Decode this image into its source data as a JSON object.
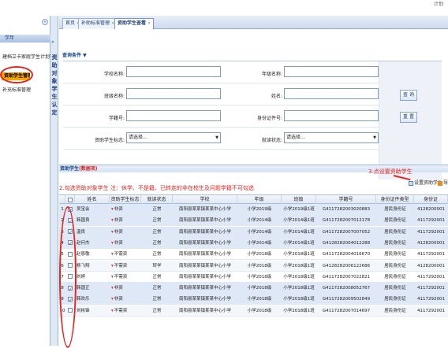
{
  "top": {
    "right_text": "计划"
  },
  "sidebar": {
    "section": "学年",
    "items": [
      "建档立卡家庭学生计划管理",
      "资助学生管理",
      "补充标准管理"
    ]
  },
  "strip": {
    "text": "资助对象学生认定"
  },
  "tabs": [
    {
      "label": "首页"
    },
    {
      "label": "补助标准管理"
    },
    {
      "label": "资助学生查看"
    }
  ],
  "query": {
    "header": "查询条件",
    "labels": {
      "school_name": "学校名称:",
      "grade_name": "年级名称:",
      "class_name": "班级名称:",
      "name": "姓名:",
      "student_no": "学籍号:",
      "id_no": "身份证件号:",
      "flag": "资助学生标志:",
      "status": "就读状态:"
    },
    "select_placeholder": "请选择...",
    "buttons": {
      "query": "查 询",
      "reset": "重 置"
    }
  },
  "grid": {
    "title": "资助学生",
    "count": "(数据项)",
    "note_left": "2.勾选资助对象学生    注：休学、不是籍、已转走的非在校生及问题学籍不可勾选",
    "note_right": "3.点设置资助学生",
    "btn_set": "设置资助学生",
    "btn_export": "导出",
    "columns": [
      "",
      "姓名",
      "资助学生标志",
      "就读状态",
      "学校",
      "年级",
      "班级",
      "学籍号",
      "身份证件类型",
      "身份证"
    ],
    "rows": [
      {
        "n": "1",
        "checked": true,
        "name": "吴宝会",
        "flag": "非资",
        "state": "正常",
        "school": "南阳县某某镇某某中心小学",
        "grade": "小学2019级",
        "cls": "小学2019级1班",
        "no": "G4117282003020883",
        "idtype": "居民身份证",
        "id": "4128200001"
      },
      {
        "n": "2",
        "checked": true,
        "name": "韩国良",
        "flag": "非资",
        "state": "正常",
        "school": "南阳县某某镇某某中心小学",
        "grade": "小学2014级",
        "cls": "小学2014级1班",
        "no": "G4117282007012178",
        "idtype": "居民身份证",
        "id": "4117292001"
      },
      {
        "n": "3",
        "checked": true,
        "name": "温良",
        "flag": "非资",
        "state": "正常",
        "school": "南阳县某某镇某某中心小学",
        "grade": "小学2014级",
        "cls": "小学2014级1班",
        "no": "G4117282007007052",
        "idtype": "居民身份证",
        "id": "4117292001"
      },
      {
        "n": "4",
        "checked": true,
        "name": "赵何杰",
        "flag": "非资",
        "state": "正常",
        "school": "南阳县某某镇某某中心小学",
        "grade": "小学2014级",
        "cls": "小学2014级1班",
        "no": "G4128282004012288",
        "idtype": "居民身份证",
        "id": "4128200001"
      },
      {
        "n": "5",
        "checked": false,
        "name": "赵恩敬",
        "flag": "不需资",
        "state": "正常",
        "school": "南阳县某某镇某某中心小学",
        "grade": "小学2018级",
        "cls": "小学2018级1班",
        "no": "G4117282004016670",
        "idtype": "居民身份证",
        "id": "4117292001"
      },
      {
        "n": "6",
        "checked": false,
        "name": "杨飞翔",
        "flag": "不需资",
        "state": "转学",
        "school": "南阳县某某镇某某中心小学",
        "grade": "小学2018级",
        "cls": "小学2018级1班",
        "no": "G4128282006122686",
        "idtype": "居民身份证",
        "id": "4128200001"
      },
      {
        "n": "7",
        "checked": false,
        "name": "刘婷",
        "flag": "不需资",
        "state": "正常",
        "school": "南阳县某某镇某某中心小学",
        "grade": "小学2018级",
        "cls": "小学2018级1班",
        "no": "G4117282007022821",
        "idtype": "居民身份证",
        "id": "4117292001"
      },
      {
        "n": "8",
        "checked": true,
        "name": "韩国正",
        "flag": "非资",
        "state": "正常",
        "school": "南阳县某某镇某某中心小学",
        "grade": "小学2018级",
        "cls": "小学2018级1班",
        "no": "G4117282008052767",
        "idtype": "居民身份证",
        "id": "4117292001"
      },
      {
        "n": "9",
        "checked": true,
        "name": "韩欢乐",
        "flag": "非资",
        "state": "正常",
        "school": "南阳县某某镇某某中心小学",
        "grade": "小学2018级",
        "cls": "小学2018级1班",
        "no": "G4117282009502849",
        "idtype": "居民身份证",
        "id": "4117292001"
      },
      {
        "n": "10",
        "checked": false,
        "name": "刘彬锋",
        "flag": "不需资",
        "state": "正常",
        "school": "南阳县某某镇某某中心小学",
        "grade": "小学2018级",
        "cls": "小学2018级1班",
        "no": "G4117282007014697",
        "idtype": "居民身份证",
        "id": "4117292001"
      }
    ]
  }
}
